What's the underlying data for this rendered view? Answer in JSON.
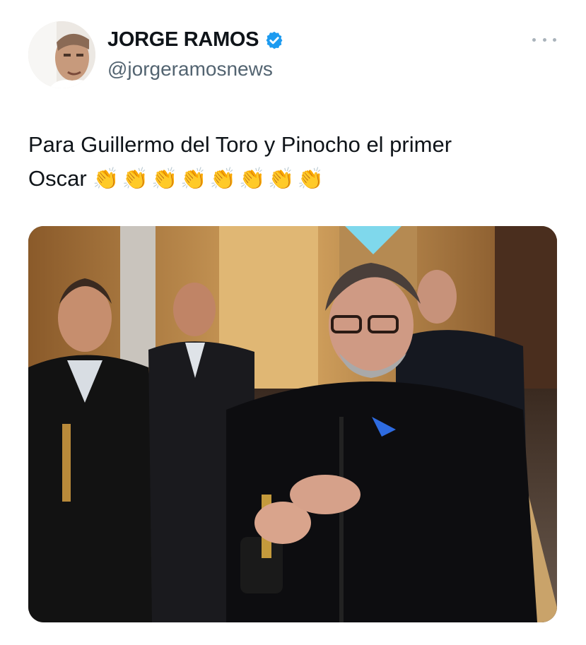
{
  "author": {
    "display_name": "JORGE RAMOS",
    "handle": "@jorgeramosnews",
    "verified": true,
    "avatar_icon": "profile-photo"
  },
  "menu": {
    "icon": "more-options-icon"
  },
  "tweet": {
    "text_line1": "Para Guillermo del Toro y Pinocho el primer",
    "text_line2": "Oscar",
    "emoji": "👏👏👏👏👏👏👏👏"
  },
  "media": {
    "type": "photo",
    "icon": "photo-media"
  },
  "colors": {
    "verified_blue": "#1d9bf0",
    "text_primary": "#0f1419",
    "text_secondary": "#536471"
  }
}
